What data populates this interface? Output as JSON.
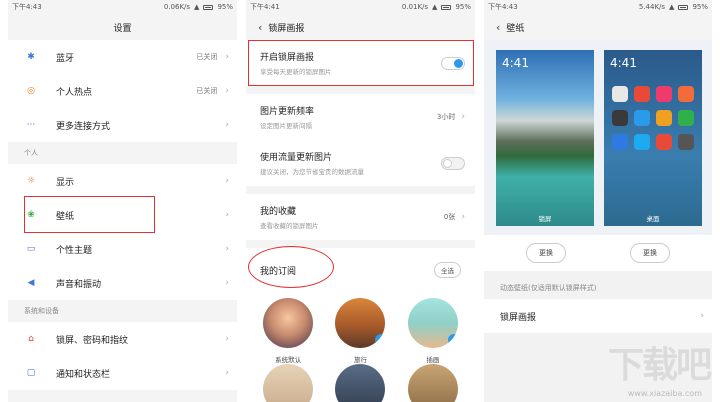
{
  "panel1": {
    "status": {
      "time": "下午4:43",
      "speed": "0.06K/s",
      "battery": "95%"
    },
    "title": "设置",
    "items_top": [
      {
        "icon": "bluetooth-icon",
        "glyph": "✱",
        "color": "#3a7bd5",
        "label": "蓝牙",
        "value": "已关闭"
      },
      {
        "icon": "hotspot-icon",
        "glyph": "◎",
        "color": "#ef7a1a",
        "label": "个人热点",
        "value": "已关闭"
      },
      {
        "icon": "more-connections-icon",
        "glyph": "···",
        "color": "#3a7bd5",
        "label": "更多连接方式",
        "value": ""
      }
    ],
    "section_personal": "个人",
    "items_personal": [
      {
        "icon": "display-icon",
        "glyph": "☼",
        "color": "#ef7a1a",
        "label": "显示"
      },
      {
        "icon": "wallpaper-icon",
        "glyph": "❀",
        "color": "#39a845",
        "label": "壁纸"
      },
      {
        "icon": "theme-icon",
        "glyph": "▭",
        "color": "#7b5cc4",
        "label": "个性主题"
      },
      {
        "icon": "sound-icon",
        "glyph": "◀",
        "color": "#3a7bd5",
        "label": "声音和振动"
      }
    ],
    "section_system": "系统和设备",
    "items_system": [
      {
        "icon": "lock-icon",
        "glyph": "⌂",
        "color": "#e23b3b",
        "label": "锁屏、密码和指纹"
      },
      {
        "icon": "notification-icon",
        "glyph": "▢",
        "color": "#3a7bd5",
        "label": "通知和状态栏"
      }
    ]
  },
  "panel2": {
    "status": {
      "time": "下午4:41",
      "speed": "0.01K/s",
      "battery": "95%"
    },
    "title": "锁屏画报",
    "lock_toggle": {
      "title": "开启锁屏画报",
      "sub": "享受每天更新的锁屏图片",
      "on": true
    },
    "frequency": {
      "title": "图片更新频率",
      "sub": "设定图片更新间隔",
      "value": "3小时"
    },
    "data_update": {
      "title": "使用流量更新图片",
      "sub": "建议关闭，为您节省宝贵的数据流量",
      "on": false
    },
    "favorites": {
      "title": "我的收藏",
      "sub": "查看收藏的锁屏图片",
      "value": "0张"
    },
    "subscriptions": {
      "title": "我的订阅",
      "all_label": "全选",
      "items": [
        {
          "name": "系统默认",
          "checked": false,
          "bg": "radial-gradient(circle at 50% 40%, #f7c8a0 0%, #c78a6e 45%, #3c2f4a 100%)"
        },
        {
          "name": "旅行",
          "checked": true,
          "bg": "linear-gradient(180deg, #d9863a 0%, #a85a2a 55%, #5a3a28 100%)"
        },
        {
          "name": "插画",
          "checked": true,
          "bg": "linear-gradient(180deg, #a6e4df 0%, #8fd0c8 50%, #e6b98f 100%)"
        },
        {
          "name": "",
          "checked": false,
          "bg": "linear-gradient(180deg, #e7d3b8 0%, #c7a98a 100%)"
        },
        {
          "name": "",
          "checked": false,
          "bg": "linear-gradient(180deg, #5a6e88 0%, #2f3a4a 100%)"
        },
        {
          "name": "",
          "checked": false,
          "bg": "linear-gradient(180deg, #c9a574 0%, #8a6a44 100%)"
        }
      ]
    }
  },
  "panel3": {
    "status": {
      "time": "下午4:43",
      "speed": "5.44K/s",
      "battery": "95%"
    },
    "title": "壁纸",
    "previews": [
      {
        "time": "4:41",
        "caption": "锁屏",
        "type": "lock"
      },
      {
        "time": "4:41",
        "caption": "桌面",
        "type": "home"
      }
    ],
    "change_label": "更换",
    "section_note": "动态壁纸(仅适用默认锁屏样式)",
    "lockscreen_row": "锁屏画报"
  },
  "watermark": {
    "big": "下载吧",
    "small": "www.xiazaiba.com"
  },
  "colors": {
    "highlight_red": "#e23131",
    "accent_blue": "#2b9ae8"
  }
}
